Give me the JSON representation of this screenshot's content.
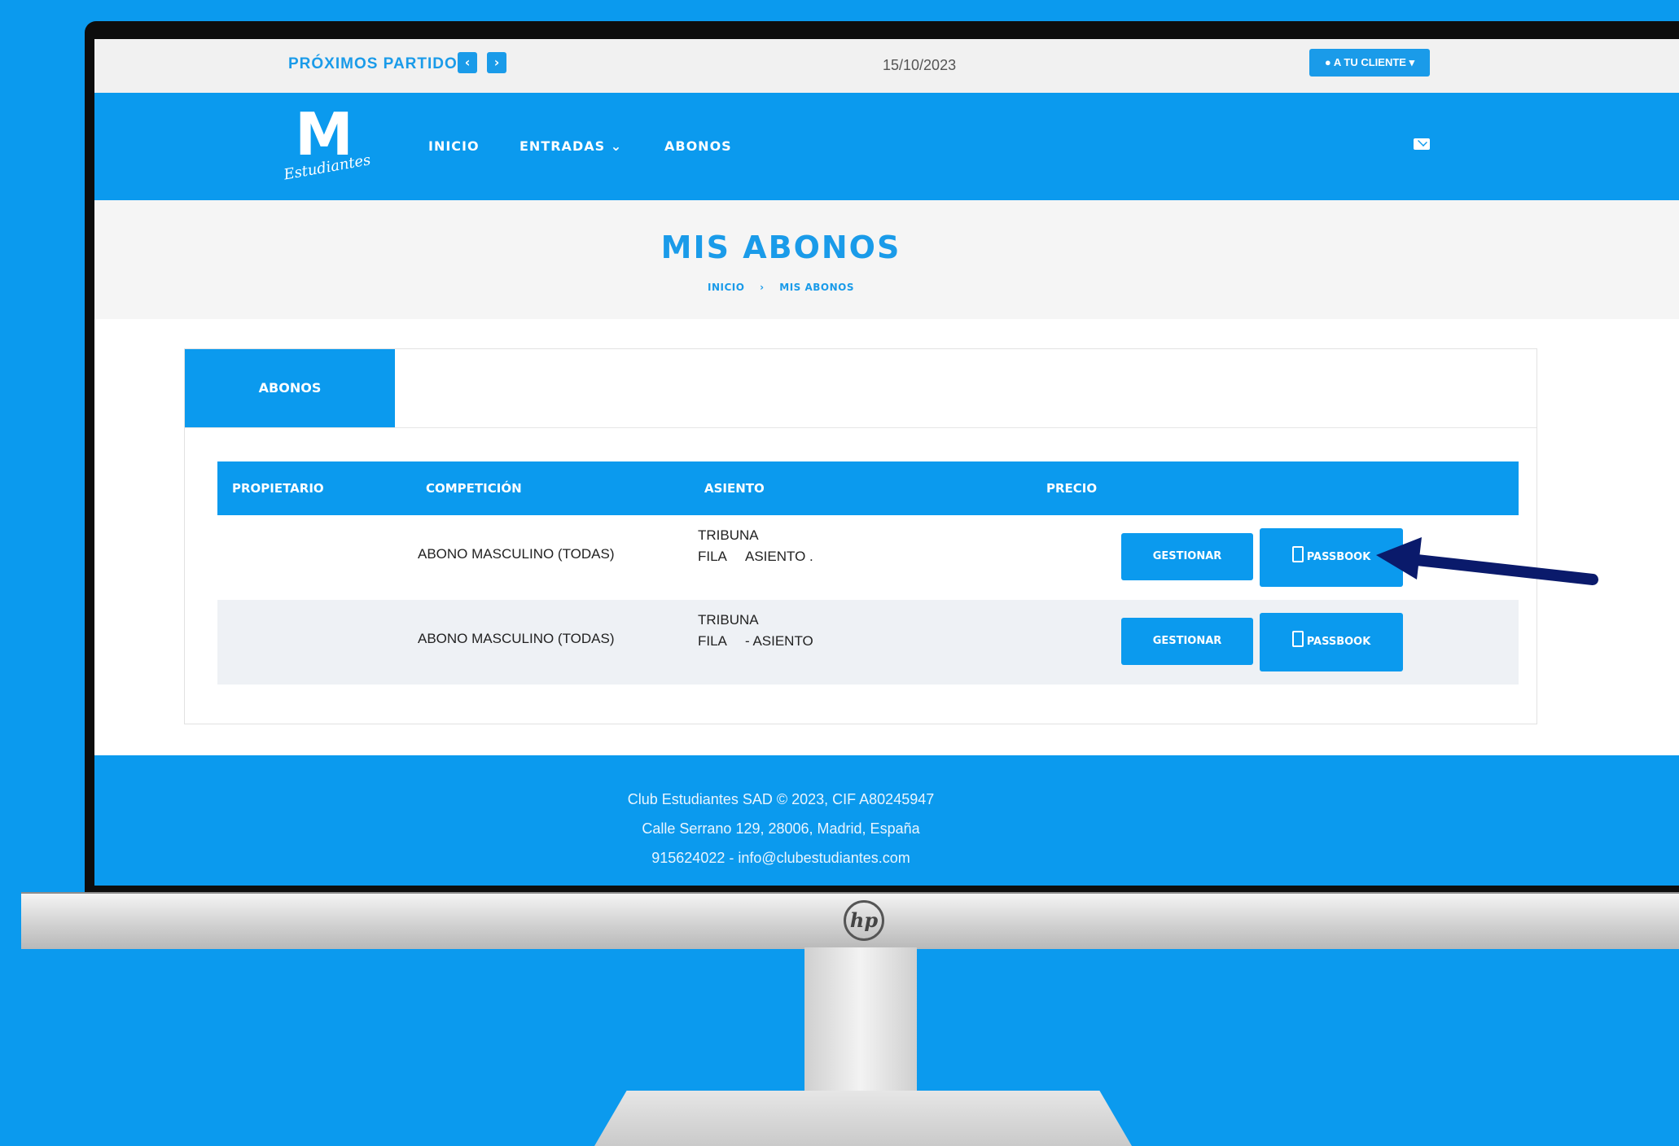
{
  "topbar": {
    "next_matches_label": "PRÓXIMOS PARTIDOS",
    "prev_glyph": "‹",
    "next_glyph": "›",
    "date": "15/10/2023",
    "account_label": "A TU CLIENTE"
  },
  "brand": {
    "mark": "M",
    "script": "Estudiantes"
  },
  "nav": {
    "inicio": "INICIO",
    "entradas": "ENTRADAS",
    "entradas_caret": "⌄",
    "abonos": "ABONOS"
  },
  "page": {
    "title": "MIS ABONOS",
    "breadcrumb": [
      "INICIO",
      "MIS ABONOS"
    ],
    "breadcrumb_sep": "›"
  },
  "tabs": {
    "abonos": "ABONOS"
  },
  "table": {
    "headers": {
      "owner": "PROPIETARIO",
      "competition": "COMPETICIÓN",
      "seat": "ASIENTO",
      "price": "PRECIO"
    },
    "rows": [
      {
        "competition": "ABONO MASCULINO (TODAS)",
        "tribuna": "TRIBUNA",
        "fila": "FILA",
        "asiento": "ASIENTO .",
        "manage_label": "GESTIONAR",
        "passbook_label": "PASSBOOK"
      },
      {
        "competition": "ABONO MASCULINO (TODAS)",
        "tribuna": "TRIBUNA",
        "fila": "FILA",
        "asiento": "- ASIENTO",
        "manage_label": "GESTIONAR",
        "passbook_label": "PASSBOOK"
      }
    ]
  },
  "footer": {
    "line1": "Club Estudiantes SAD © 2023, CIF A80245947",
    "line2": "Calle Serrano 129, 28006, Madrid, España",
    "line3": "915624022 - info@clubestudiantes.com"
  },
  "monitor": {
    "brand": "hp"
  },
  "colors": {
    "background": "#0b9aee",
    "accent": "#1a9be9",
    "arrow": "#0a1a6b"
  }
}
